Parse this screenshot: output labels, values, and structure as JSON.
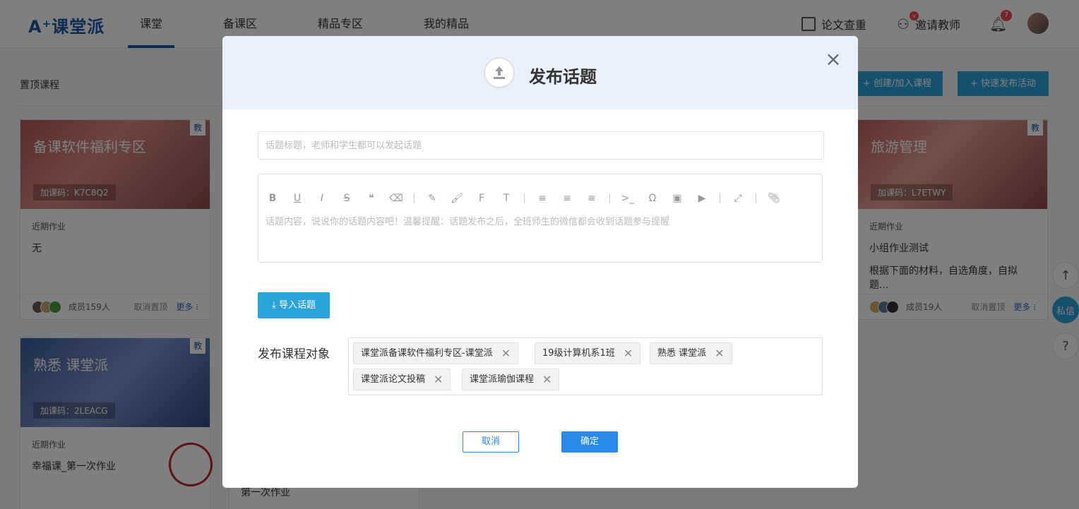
{
  "header": {
    "logo": "A⁺课堂派",
    "nav": [
      "课堂",
      "备课区",
      "精品专区",
      "我的精品"
    ],
    "thesis_check": "论文查重",
    "invite_teacher": "邀请教师",
    "notification_count": "7"
  },
  "page": {
    "pinned_label": "置顶课程",
    "create_button": "+ 创建/加入课程",
    "quick_button": "+ 快速发布活动"
  },
  "cards": [
    {
      "title": "备课软件福利专区",
      "code": "加课码：K7C8Q2",
      "tag": "教",
      "hw_label": "近期作业",
      "hw": "无",
      "hw2": "",
      "members": "成员159人",
      "unpin": "取消置顶",
      "more": "更多 ⁝"
    },
    {
      "title": "旅游管理",
      "code": "加课码：L7ETWY",
      "tag": "教",
      "hw_label": "近期作业",
      "hw": "小组作业测试",
      "hw2": "根据下面的材料，自选角度，自拟题...",
      "members": "成员19人",
      "unpin": "取消置顶",
      "more": "更多 ⁝"
    },
    {
      "title": "熟悉 课堂派",
      "code": "加课码：2LEACG",
      "tag": "教",
      "hw_label": "近期作业",
      "hw": "幸福课_第一次作业",
      "hw2": "",
      "members": "",
      "unpin": "",
      "more": ""
    }
  ],
  "behind_text": "第一次作业",
  "side": {
    "private_msg": "私信"
  },
  "modal": {
    "title": "发布话题",
    "title_placeholder": "话题标题，老师和学生都可以发起话题",
    "content_placeholder": "话题内容，说说你的话题内容吧！温馨提醒：话题发布之后，全班师生的微信都会收到话题参与提醒",
    "import_button": "导入话题",
    "target_label": "发布课程对象",
    "targets": [
      "课堂派备课软件福利专区-课堂派",
      "19级计算机系1班",
      "熟悉 课堂派",
      "课堂派论文投稿",
      "课堂派瑜伽课程"
    ],
    "cancel": "取消",
    "confirm": "确定"
  }
}
